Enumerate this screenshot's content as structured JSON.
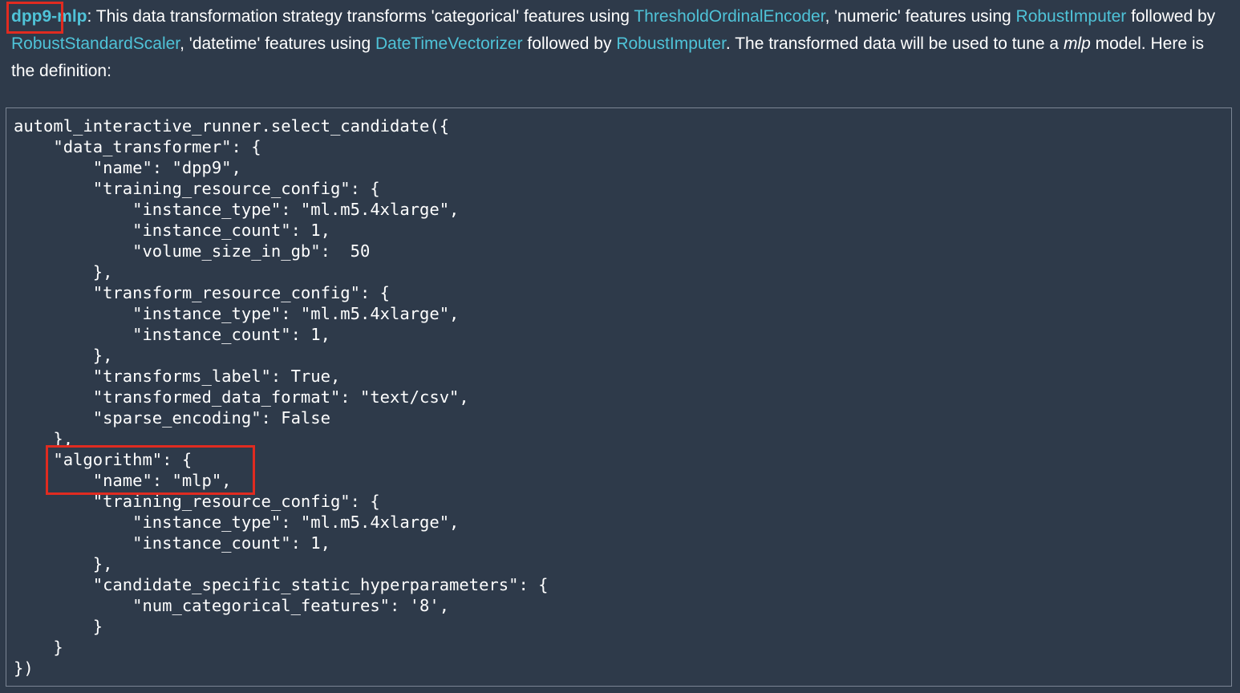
{
  "intro": {
    "candidate_name_prefix": "dpp9",
    "candidate_separator": "-",
    "candidate_name_suffix": "mlp",
    "text1": ": This data transformation strategy transforms 'categorical' features using ",
    "link_threshold": "ThresholdOrdinalEncoder",
    "text2": ", 'numeric' features using ",
    "link_robust_imputer_1": "RobustImputer",
    "text3": " followed by ",
    "link_robust_scaler": "RobustStandardScaler",
    "text4": ", 'datetime' features using ",
    "link_datetime": "DateTimeVectorizer",
    "text5": " followed by ",
    "link_robust_imputer_2": "RobustImputer",
    "text6": ". The transformed data will be used to tune a ",
    "model_name": "mlp",
    "text7": " model. Here is the definition:"
  },
  "code": {
    "lines": [
      "automl_interactive_runner.select_candidate({",
      "    \"data_transformer\": {",
      "        \"name\": \"dpp9\",",
      "        \"training_resource_config\": {",
      "            \"instance_type\": \"ml.m5.4xlarge\",",
      "            \"instance_count\": 1,",
      "            \"volume_size_in_gb\":  50",
      "        },",
      "        \"transform_resource_config\": {",
      "            \"instance_type\": \"ml.m5.4xlarge\",",
      "            \"instance_count\": 1,",
      "        },",
      "        \"transforms_label\": True,",
      "        \"transformed_data_format\": \"text/csv\",",
      "        \"sparse_encoding\": False",
      "    },",
      "    \"algorithm\": {",
      "        \"name\": \"mlp\",",
      "        \"training_resource_config\": {",
      "            \"instance_type\": \"ml.m5.4xlarge\",",
      "            \"instance_count\": 1,",
      "        },",
      "        \"candidate_specific_static_hyperparameters\": {",
      "            \"num_categorical_features\": '8',",
      "        }",
      "    }",
      "})"
    ]
  },
  "colors": {
    "background": "#2e3a4a",
    "link": "#4fc3d8",
    "highlight_box": "#e02b20",
    "code_border": "#7b8594"
  }
}
